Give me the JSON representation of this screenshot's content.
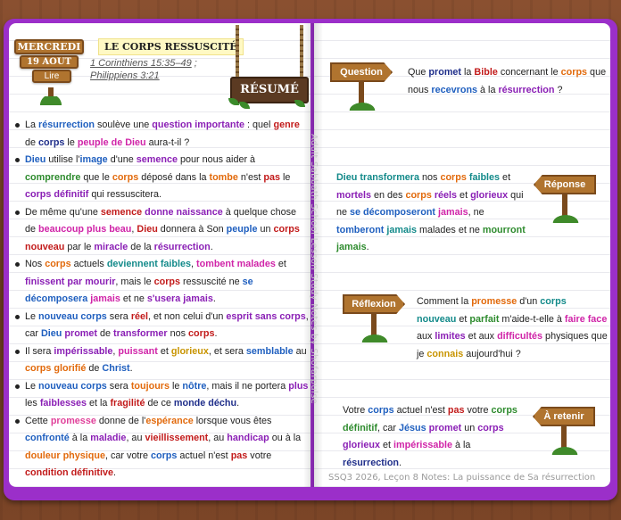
{
  "header": {
    "day": "MERCREDI",
    "date": "19 AOUT",
    "read_label": "Lire",
    "title": "LE CORPS RESSUSCITÉ",
    "ref_line1": "1 Corinthiens 15:35–49",
    "ref_sep": " ;",
    "ref_line2": "Philippiens 3:21",
    "resume": "RÉSUMÉ"
  },
  "vertical_credit": "Adult Sabbath School Lesson Study Notes by Shofarpulse",
  "footer": "SSQ3 2026, Leçon 8 Notes: La puissance de Sa résurrection",
  "signs": {
    "question": "Question",
    "reponse": "Réponse",
    "reflexion": "Réflexion",
    "retenir": "À retenir"
  },
  "colors": {
    "cover": "#9b2fc9",
    "wood": "#7a4526",
    "sign": "#b0742f"
  }
}
